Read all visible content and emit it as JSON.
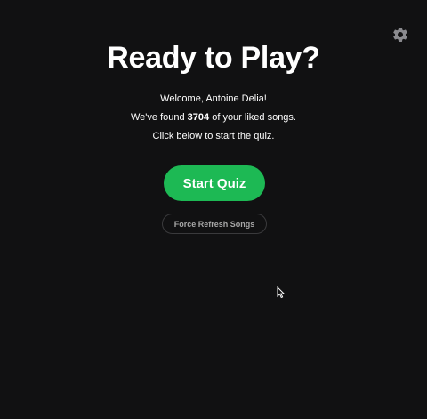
{
  "header": {
    "settings_icon": "gear-icon"
  },
  "main": {
    "title": "Ready to Play?",
    "welcome_text": "Welcome, Antoine Delia!",
    "found_prefix": "We've found ",
    "song_count": "3704",
    "found_suffix": " of your liked songs.",
    "instruction_text": "Click below to start the quiz.",
    "start_button_label": "Start Quiz",
    "refresh_button_label": "Force Refresh Songs"
  },
  "colors": {
    "background": "#111112",
    "accent": "#1db954",
    "muted_text": "#a7a7a7"
  }
}
